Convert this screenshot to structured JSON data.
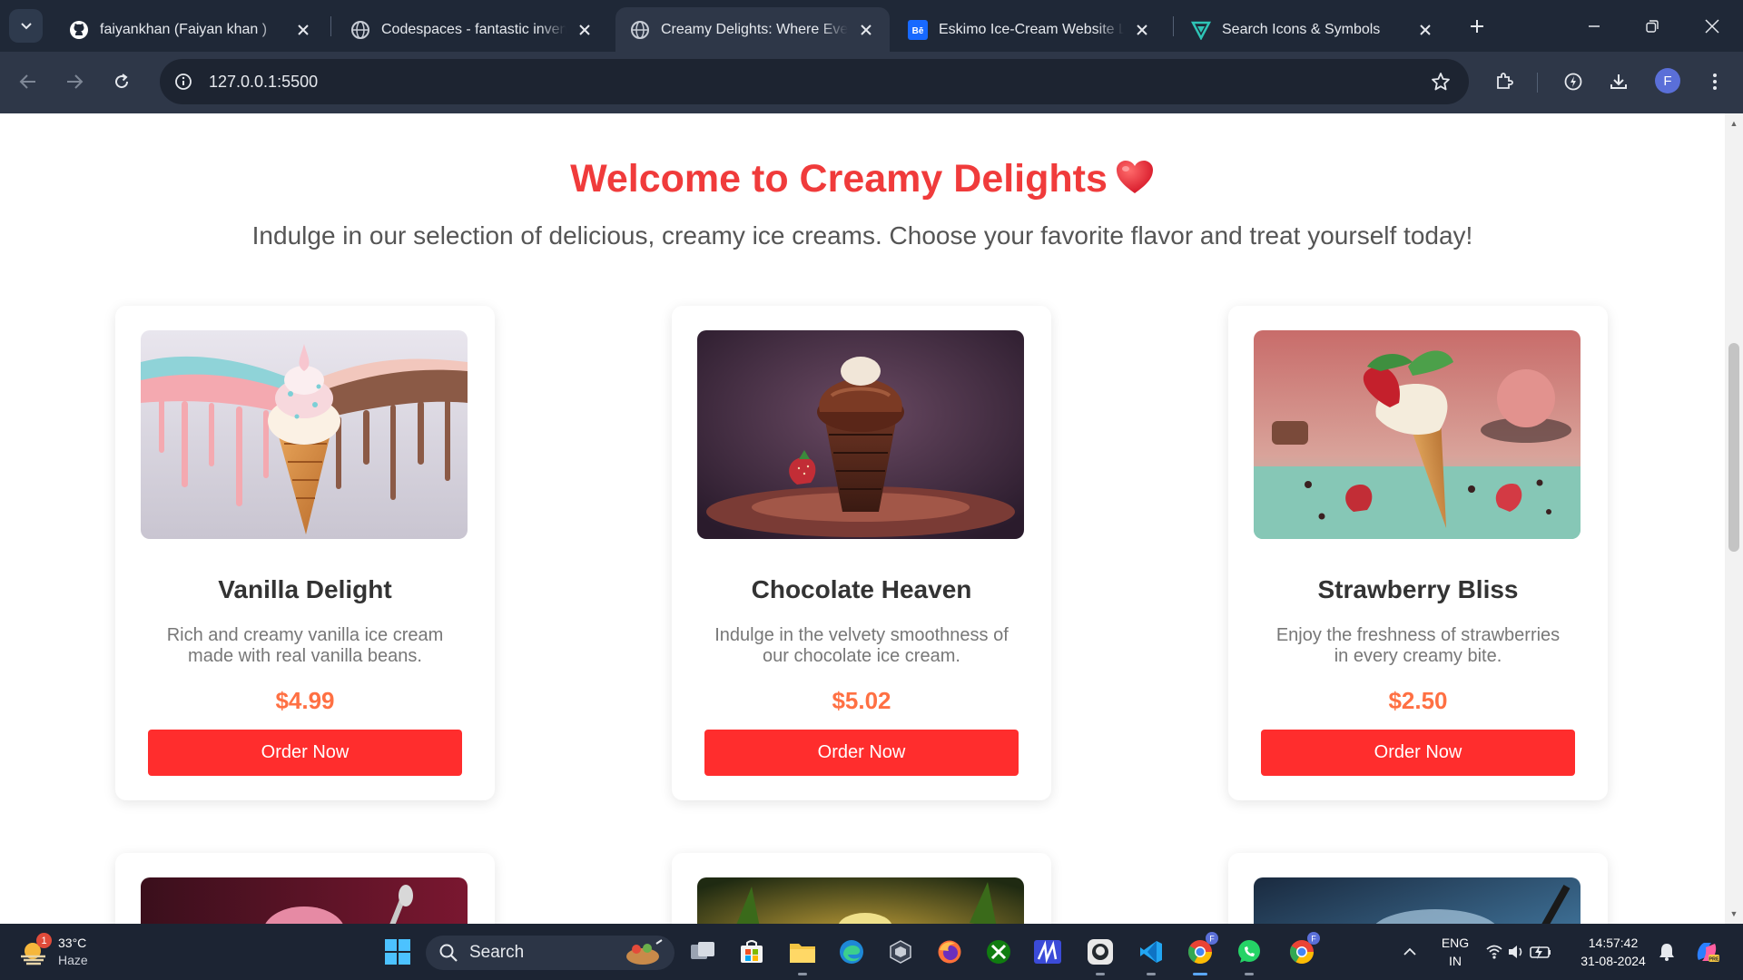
{
  "browser": {
    "tabs": [
      {
        "title": "faiyankhan (Faiyan khan )",
        "icon": "github-icon",
        "active": false
      },
      {
        "title": "Codespaces - fantastic inventi",
        "icon": "globe-icon",
        "active": false
      },
      {
        "title": "Creamy Delights: Where Every",
        "icon": "globe-icon",
        "active": true
      },
      {
        "title": "Eskimo Ice-Cream Website La",
        "icon": "behance-icon",
        "active": false
      },
      {
        "title": "Search Icons & Symbols",
        "icon": "vectr-icon",
        "active": false
      }
    ],
    "url": "127.0.0.1:5500",
    "profile_initial": "F"
  },
  "page": {
    "heading": "Welcome to Creamy Delights",
    "subtitle": "Indulge in our selection of delicious, creamy ice creams. Choose your favorite flavor and treat yourself today!",
    "products": [
      {
        "name": "Vanilla Delight",
        "description": "Rich and creamy vanilla ice cream made with real vanilla beans.",
        "price": "$4.99",
        "button": "Order Now"
      },
      {
        "name": "Chocolate Heaven",
        "description": "Indulge in the velvety smoothness of our chocolate ice cream.",
        "price": "$5.02",
        "button": "Order Now"
      },
      {
        "name": "Strawberry Bliss",
        "description": "Enjoy the freshness of strawberries in every creamy bite.",
        "price": "$2.50",
        "button": "Order Now"
      }
    ],
    "colors": {
      "heading": "#f03b3b",
      "price": "#ff7043",
      "button": "#ff2d2d"
    }
  },
  "taskbar": {
    "weather": {
      "temp": "33°C",
      "condition": "Haze",
      "badge": "1"
    },
    "search_label": "Search",
    "language": {
      "line1": "ENG",
      "line2": "IN"
    },
    "time": "14:57:42",
    "date": "31-08-2024",
    "profile_badge": "F"
  }
}
